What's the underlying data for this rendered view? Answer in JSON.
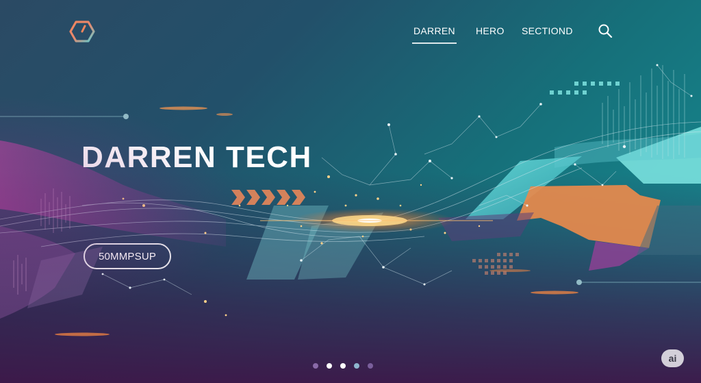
{
  "nav": {
    "items": [
      {
        "label": "DARREN",
        "active": true
      },
      {
        "label": "HERO",
        "active": false
      },
      {
        "label": "SECTIOND",
        "active": false
      }
    ]
  },
  "icons": {
    "logo": "hexagon-logo-icon",
    "search": "search-icon"
  },
  "hero": {
    "title": "DARREN TECH",
    "cta_label": "50MMPSUP"
  },
  "carousel": {
    "count": 5,
    "active_index": 2
  },
  "badge": {
    "label": "ai"
  },
  "colors": {
    "accent_teal": "#5ad3d6",
    "accent_orange": "#e88a4c",
    "accent_purple": "#9b3f9a",
    "text": "#ffffff"
  }
}
